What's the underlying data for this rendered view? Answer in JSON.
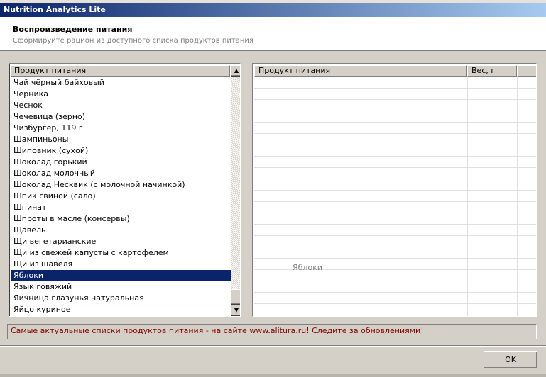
{
  "window": {
    "title": "Nutrition Analytics Lite"
  },
  "header": {
    "title": "Воспроизведение питания",
    "subtitle": "Сформируйте рацион из доступного списка продуктов питания"
  },
  "left_list": {
    "column_header": "Продукт питания",
    "selected": "Яблоки",
    "items": [
      "Чай чёрный байховый",
      "Черника",
      "Чеснок",
      "Чечевица (зерно)",
      "Чизбургер, 119 г",
      "Шампиньоны",
      "Шиповник (сухой)",
      "Шоколад горький",
      "Шоколад молочный",
      "Шоколад Несквик (с молочной начинкой)",
      "Шпик свиной (сало)",
      "Шпинат",
      "Шпроты в масле (консервы)",
      "Щавель",
      "Щи вегетарианские",
      "Щи из свежей капусты с картофелем",
      "Щи из щавеля",
      "Яблоки",
      "Язык говяжий",
      "Яичница глазунья натуральная",
      "Яйцо куриное"
    ],
    "scroll_position": 0.95
  },
  "right_list": {
    "col_product": "Продукт питания",
    "col_weight": "Вес, г",
    "drag_ghost": "Яблоки",
    "row_count": 21
  },
  "banner_text": "Самые актуальные списки продуктов питания - на сайте www.alitura.ru! Следите за обновлениями!",
  "buttons": {
    "ok": "OK"
  },
  "icons": {
    "scroll_up": "arrow-up-icon",
    "scroll_down": "arrow-down-icon"
  }
}
